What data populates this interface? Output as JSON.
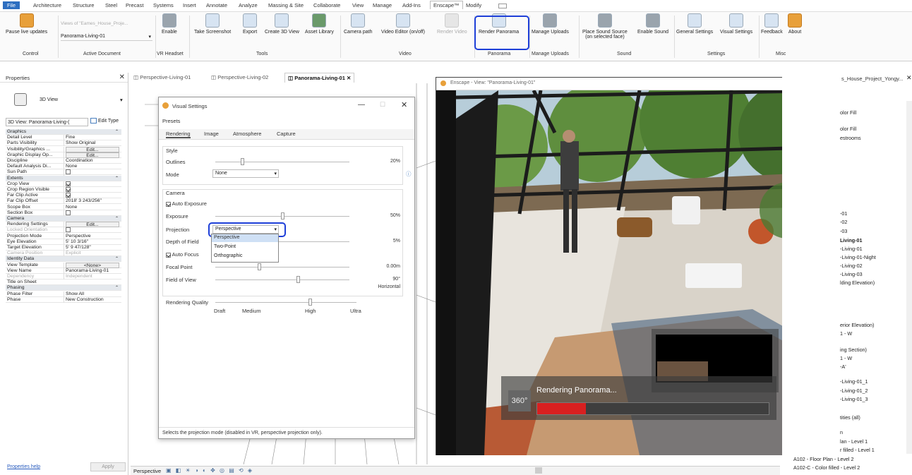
{
  "menubar": {
    "items": [
      "File",
      "Architecture",
      "Structure",
      "Steel",
      "Precast",
      "Systems",
      "Insert",
      "Annotate",
      "Analyze",
      "Massing & Site",
      "Collaborate",
      "View",
      "Manage",
      "Add-Ins",
      "Enscape™",
      "Modify"
    ],
    "active": "Enscape™"
  },
  "ribbon": {
    "pause_updates": "Pause live updates",
    "views_placeholder": "Views of \"Eames_House_Proje...",
    "doc_select": "Panorama-Living-01",
    "enable": "Enable",
    "screenshot": "Take Screenshot",
    "export": "Export",
    "create3d": "Create 3D View",
    "asset": "Asset Library",
    "campath": "Camera path",
    "video_editor": "Video Editor (on/off)",
    "render_video": "Render Video",
    "render_panorama": "Render Panorama",
    "manage_uploads": "Manage Uploads",
    "place_sound": "Place Sound Source",
    "place_sound_sub": "(on selected face)",
    "enable_sound": "Enable Sound",
    "general_settings": "General Settings",
    "visual_settings": "Visual Settings",
    "feedback": "Feedback",
    "about": "About",
    "groups": {
      "control": "Control",
      "active_document": "Active Document",
      "vr": "VR Headset",
      "tools": "Tools",
      "video": "Video",
      "panorama": "Panorama",
      "uploads": "Manage Uploads",
      "sound": "Sound",
      "settings": "Settings",
      "misc": "Misc"
    }
  },
  "doc_tabs": [
    "Perspective-Living-01",
    "Perspective-Living-02",
    "Panorama-Living-01"
  ],
  "properties": {
    "title": "Properties",
    "type": "3D View",
    "view_selector": "3D View: Panorama-Living-(",
    "edit_type": "Edit Type",
    "rows": [
      {
        "k": "Graphics",
        "cat": true
      },
      {
        "k": "Detail Level",
        "v": "Fine"
      },
      {
        "k": "Parts Visibility",
        "v": "Show Original"
      },
      {
        "k": "Visibility/Graphics ...",
        "v": "Edit...",
        "btn": true
      },
      {
        "k": "Graphic Display Op...",
        "v": "Edit...",
        "btn": true
      },
      {
        "k": "Discipline",
        "v": "Coordination"
      },
      {
        "k": "Default Analysis Di...",
        "v": "None"
      },
      {
        "k": "Sun Path",
        "chk": false
      },
      {
        "k": "Extents",
        "cat": true
      },
      {
        "k": "Crop View",
        "chk": true
      },
      {
        "k": "Crop Region Visible",
        "chk": true
      },
      {
        "k": "Far Clip Active",
        "chk": true
      },
      {
        "k": "Far Clip Offset",
        "v": "2018'  3 243/256\""
      },
      {
        "k": "Scope Box",
        "v": "None"
      },
      {
        "k": "Section Box",
        "chk": false
      },
      {
        "k": "Camera",
        "cat": true
      },
      {
        "k": "Rendering Settings",
        "v": "Edit...",
        "btn": true
      },
      {
        "k": "Locked Orientation",
        "chk": false,
        "dis": true
      },
      {
        "k": "Projection Mode",
        "v": "Perspective"
      },
      {
        "k": "Eye Elevation",
        "v": "5'  10 3/16\""
      },
      {
        "k": "Target Elevation",
        "v": "5'  9 47/128\""
      },
      {
        "k": "Camera Position",
        "v": "Explicit",
        "dis": true
      },
      {
        "k": "Identity Data",
        "cat": true
      },
      {
        "k": "View Template",
        "v": "<None>",
        "btn": true
      },
      {
        "k": "View Name",
        "v": "Panorama-Living-01"
      },
      {
        "k": "Dependency",
        "v": "Independent",
        "dis": true
      },
      {
        "k": "Title on Sheet",
        "v": ""
      },
      {
        "k": "Phasing",
        "cat": true
      },
      {
        "k": "Phase Filter",
        "v": "Show All"
      },
      {
        "k": "Phase",
        "v": "New Construction"
      }
    ],
    "help": "Properties help",
    "apply": "Apply"
  },
  "visual_settings": {
    "title": "Visual Settings",
    "presets": "Presets",
    "tabs": [
      "Rendering",
      "Image",
      "Atmosphere",
      "Capture"
    ],
    "style_label": "Style",
    "outlines": "Outlines",
    "outlines_val": "20%",
    "outlines_level": 0.2,
    "mode": "Mode",
    "mode_val": "None",
    "camera_label": "Camera",
    "auto_exposure": "Auto Exposure",
    "exposure": "Exposure",
    "exposure_val": "50%",
    "exposure_level": 0.5,
    "projection": "Projection",
    "projection_val": "Perspective",
    "projection_options": [
      "Perspective",
      "Two-Point",
      "Orthographic"
    ],
    "dof": "Depth of Field",
    "dof_val": "5%",
    "auto_focus": "Auto Focus",
    "focal": "Focal Point",
    "focal_val": "0.00m",
    "fov": "Field of View",
    "fov_val": "90°",
    "fov_sub": "Horizontal",
    "quality": "Rendering Quality",
    "quality_levels": [
      "Draft",
      "Medium",
      "High",
      "Ultra"
    ],
    "quality_selected": "High",
    "footer": "Selects the projection mode (disabled in VR, perspective projection only)."
  },
  "enscape": {
    "title": "Enscape - View: \"Panorama-Living-01\"",
    "rendering_text": "Rendering Panorama...",
    "badge": "360°",
    "progress": 0.21
  },
  "project_browser": {
    "title": "s_House_Project_Yongy...",
    "items": [
      "olor Fill",
      "olor Fill",
      "estrooms",
      "-01",
      "-02",
      "-03",
      "Living-01",
      "-Living-01",
      "-Living-01-Night",
      "-Living-02",
      "-Living-03",
      "lding Elevation)",
      "erior Elevation)",
      "1 - W",
      "ing Section)",
      "1 - W",
      "-A'",
      "-Living-01_1",
      "-Living-01_2",
      "-Living-01_3",
      "tities (all)",
      "n",
      "lan - Level 1",
      "r filled - Level 1",
      "A102 - Floor Plan - Level 2",
      "A102-C - Color filled - Level 2"
    ]
  },
  "statusbar": {
    "view": "Perspective"
  }
}
